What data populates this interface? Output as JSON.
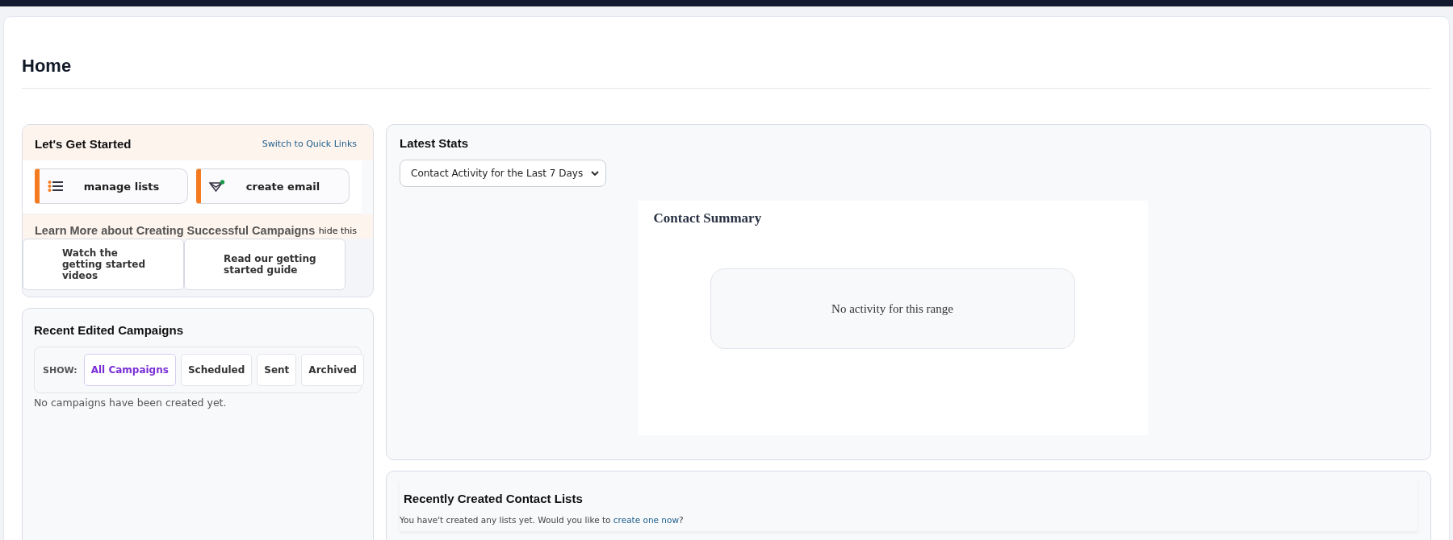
{
  "page_title": "Home",
  "get_started": {
    "title": "Let's Get Started",
    "switch_link": "Switch to Quick Links",
    "actions": [
      {
        "kind": "lists",
        "label": "manage lists"
      },
      {
        "kind": "email",
        "label": "create email"
      }
    ],
    "learn_title": "Learn More about Creating Successful Campaigns",
    "hide_link": "hide this",
    "resources": [
      "Watch the getting started videos",
      "Read our getting started guide"
    ]
  },
  "campaigns": {
    "title": "Recent Edited Campaigns",
    "show_label": "SHOW:",
    "filters": [
      {
        "label": "All Campaigns",
        "selected": true
      },
      {
        "label": "Scheduled",
        "selected": false
      },
      {
        "label": "Sent",
        "selected": false
      },
      {
        "label": "Archived",
        "selected": false
      }
    ],
    "empty": "No campaigns have been created yet."
  },
  "stats": {
    "title": "Latest Stats",
    "range": "Contact Activity for the Last 7 Days",
    "chart_title": "Contact Summary",
    "empty": "No activity for this range"
  },
  "contact_lists": {
    "title": "Recently Created Contact Lists",
    "before": "You have't created any lists yet. Would you like to ",
    "link": "create one now",
    "after": "?"
  }
}
